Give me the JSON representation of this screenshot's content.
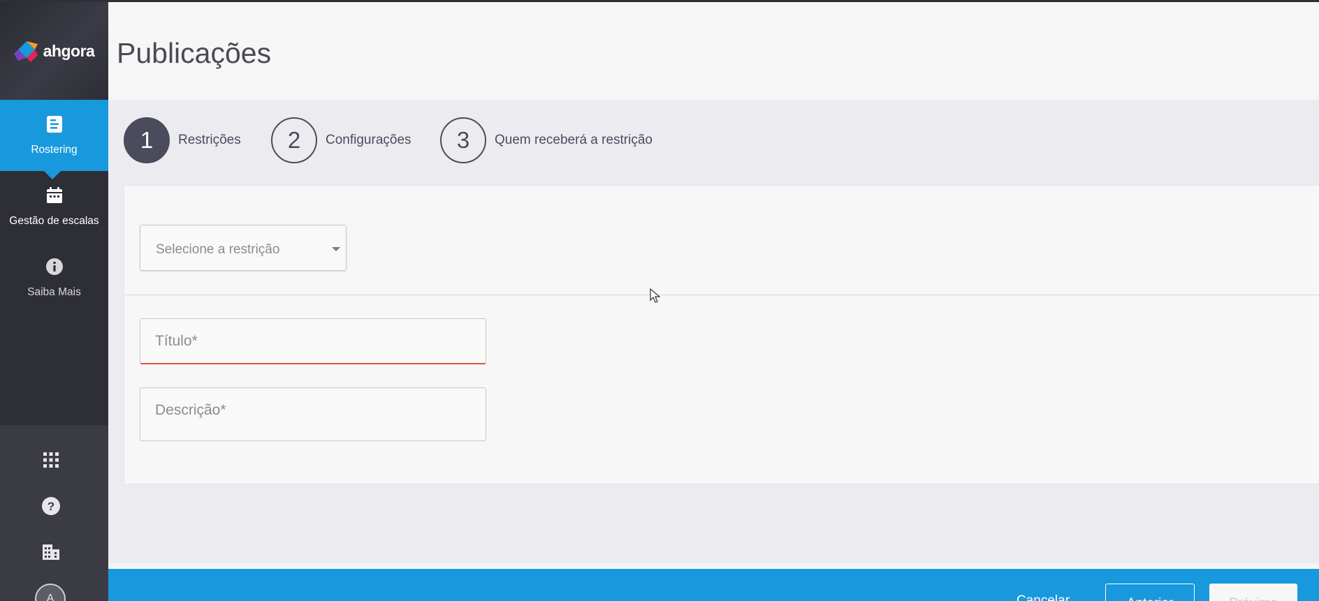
{
  "brand": {
    "logo_text": "ahgora",
    "colors": {
      "accent": "#1899dd",
      "sidebar": "#2d2e36",
      "error": "#e2503f",
      "step": "#4a4b5c"
    }
  },
  "sidebar": {
    "items": [
      {
        "label": "Rostering",
        "icon": "document-list-icon",
        "active": true
      },
      {
        "label": "Gestão de escalas",
        "icon": "calendar-icon",
        "active": false
      },
      {
        "label": "Saiba Mais",
        "icon": "info-icon",
        "active": false
      }
    ],
    "bottom_icons": [
      "apps-grid-icon",
      "help-icon",
      "building-icon"
    ],
    "avatar_initial": "A"
  },
  "header": {
    "title": "Publicações"
  },
  "stepper": {
    "steps": [
      {
        "number": "1",
        "label": "Restrições",
        "active": true
      },
      {
        "number": "2",
        "label": "Configurações",
        "active": false
      },
      {
        "number": "3",
        "label": "Quem receberá a restrição",
        "active": false
      }
    ]
  },
  "form": {
    "restriction_select": {
      "placeholder": "Selecione a restrição"
    },
    "title_field": {
      "placeholder": "Título*",
      "value": ""
    },
    "description_field": {
      "placeholder": "Descrição*",
      "value": ""
    }
  },
  "footer": {
    "cancel_label": "Cancelar",
    "previous_label": "Anterior",
    "next_label": "Próximo"
  }
}
